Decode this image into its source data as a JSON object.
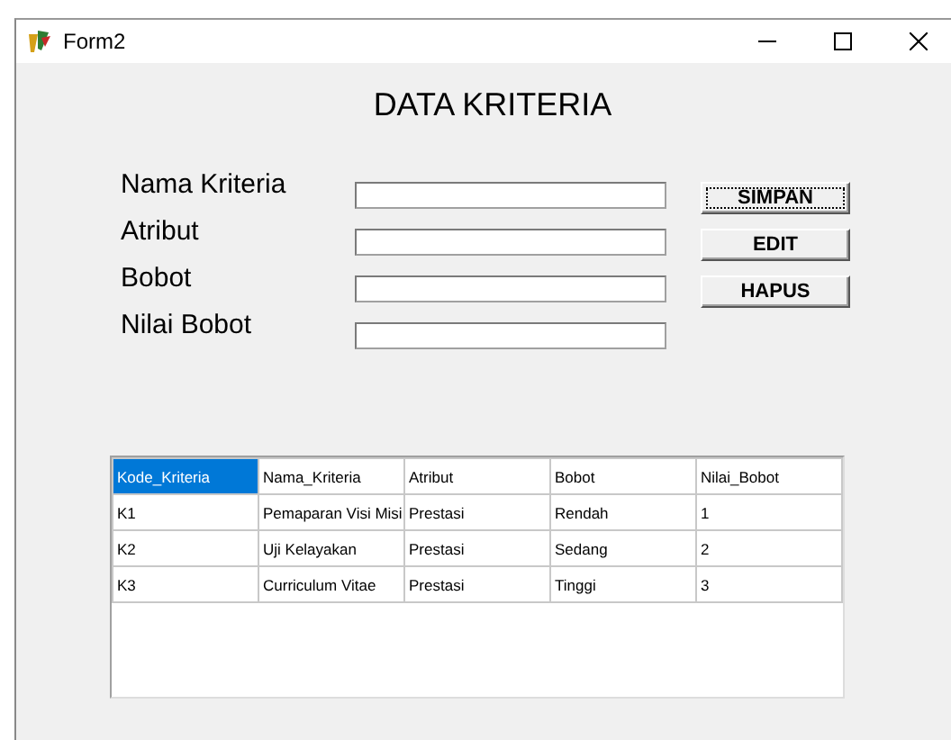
{
  "window": {
    "title": "Form2"
  },
  "heading": "DATA KRITERIA",
  "fields": [
    {
      "label": "Nama Kriteria"
    },
    {
      "label": "Atribut"
    },
    {
      "label": "Bobot"
    },
    {
      "label": "Nilai Bobot"
    }
  ],
  "buttons": [
    {
      "label": "SIMPAN",
      "focused": true
    },
    {
      "label": "EDIT",
      "focused": false
    },
    {
      "label": "HAPUS",
      "focused": false
    }
  ],
  "table": {
    "columns": [
      {
        "label": "Kode_Kriteria",
        "selected": true
      },
      {
        "label": "Nama_Kriteria",
        "selected": false
      },
      {
        "label": "Atribut",
        "selected": false
      },
      {
        "label": "Bobot",
        "selected": false
      },
      {
        "label": "Nilai_Bobot",
        "selected": false
      }
    ],
    "rows": [
      [
        "K1",
        "Pemaparan Visi Misi",
        "Prestasi",
        "Rendah",
        "1"
      ],
      [
        "K2",
        "Uji Kelayakan",
        "Prestasi",
        "Sedang",
        "2"
      ],
      [
        "K3",
        "Curriculum Vitae",
        "Prestasi",
        "Tinggi",
        "3"
      ]
    ]
  }
}
